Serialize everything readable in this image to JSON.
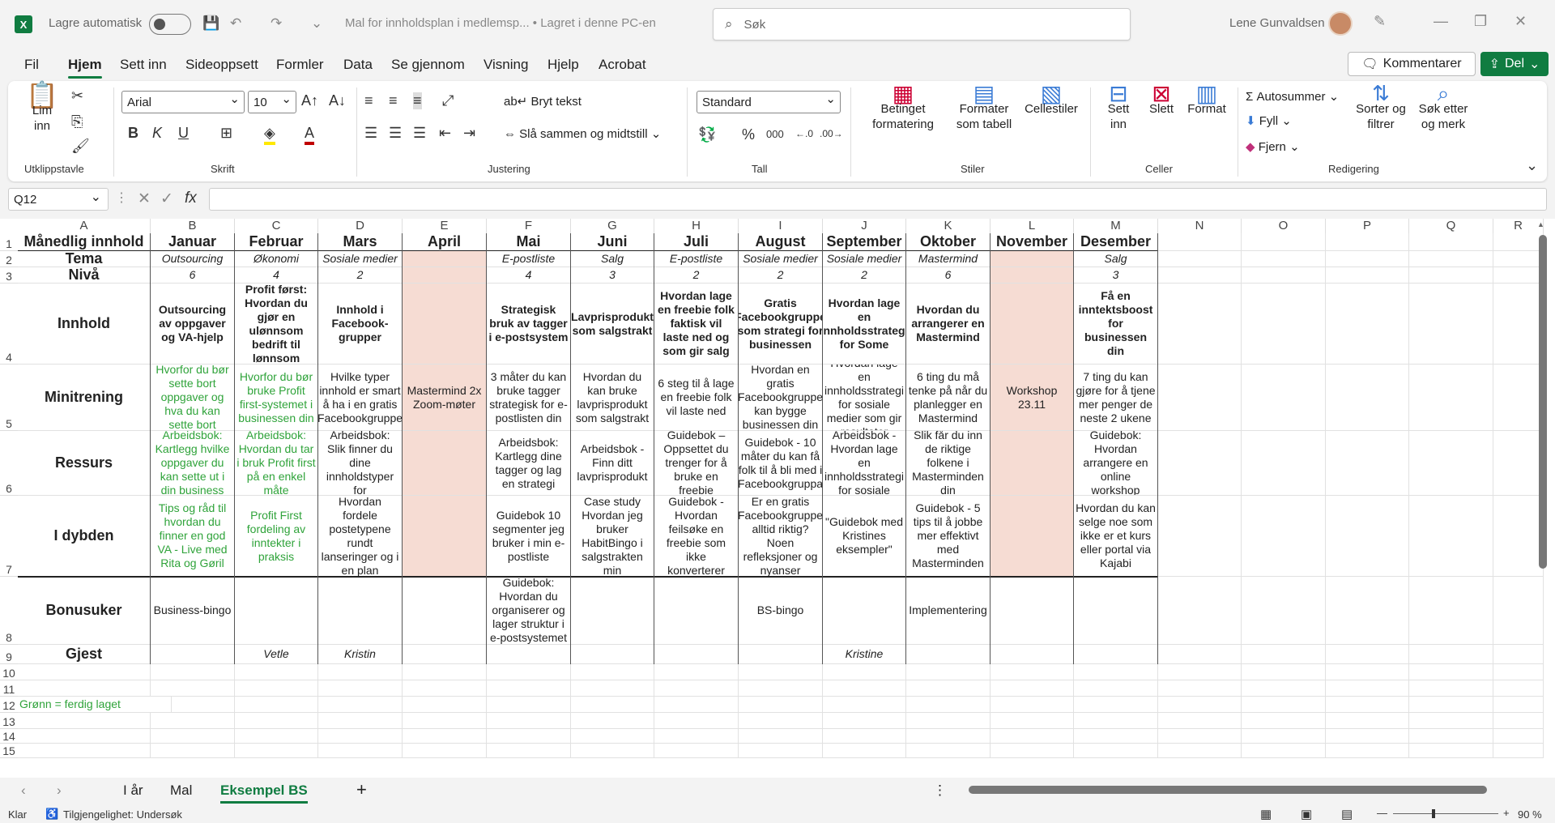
{
  "titlebar": {
    "app_icon": "X",
    "autosave_label": "Lagre automatisk",
    "doc_title": "Mal for innholdsplan i medlemsp...",
    "save_state": "• Lagret i denne PC-en",
    "search_placeholder": "Søk",
    "user_name": "Lene Gunvaldsen"
  },
  "menu": {
    "items": [
      "Fil",
      "Hjem",
      "Sett inn",
      "Sideoppsett",
      "Formler",
      "Data",
      "Se gjennom",
      "Visning",
      "Hjelp",
      "Acrobat"
    ],
    "active": "Hjem",
    "comments_label": "Kommentarer",
    "share_label": "Del"
  },
  "ribbon": {
    "groups": {
      "clipboard": "Utklippstavle",
      "font": "Skrift",
      "alignment": "Justering",
      "number": "Tall",
      "styles": "Stiler",
      "cells": "Celler",
      "editing": "Redigering"
    },
    "paste_label": "Lim inn",
    "font_name": "Arial",
    "font_size": "10",
    "wrap_text": "Bryt tekst",
    "merge_center": "Slå sammen og midtstill",
    "number_format": "Standard",
    "conditional_formatting": "Betinget formatering",
    "format_as_table": "Formater som tabell",
    "cell_styles": "Cellestiler",
    "insert": "Sett inn",
    "delete": "Slett",
    "format": "Format",
    "autosum": "Autosummer",
    "fill": "Fyll",
    "clear": "Fjern",
    "sort_filter": "Sorter og filtrer",
    "find_select": "Søk etter og merk"
  },
  "formula_bar": {
    "name_box": "Q12",
    "formula": ""
  },
  "columns": [
    "A",
    "B",
    "C",
    "D",
    "E",
    "F",
    "G",
    "H",
    "I",
    "J",
    "K",
    "L",
    "M",
    "N",
    "O",
    "P",
    "Q",
    "R"
  ],
  "rows": [
    "1",
    "2",
    "3",
    "4",
    "5",
    "6",
    "7",
    "8",
    "9",
    "10",
    "11",
    "12",
    "13",
    "14",
    "15"
  ],
  "sheet": {
    "row_labels": [
      "Månedlig innhold",
      "Tema",
      "Nivå",
      "Innhold",
      "Minitrening",
      "Ressurs",
      "I dybden",
      "Bonusuker",
      "Gjest"
    ],
    "months": [
      "Januar",
      "Februar",
      "Mars",
      "April",
      "Mai",
      "Juni",
      "Juli",
      "August",
      "September",
      "Oktober",
      "November",
      "Desember"
    ],
    "tema": [
      "Outsourcing",
      "Økonomi",
      "Sosiale medier",
      "",
      "E-postliste",
      "Salg",
      "E-postliste",
      "Sosiale medier",
      "Sosiale medier",
      "Mastermind",
      "",
      "Salg"
    ],
    "niva": [
      "6",
      "4",
      "2",
      "",
      "4",
      "3",
      "2",
      "2",
      "2",
      "6",
      "",
      "3"
    ],
    "innhold": [
      "Outsourcing av oppgaver og VA-hjelp",
      "Profit først: Hvordan du gjør en ulønnsom bedrift til lønnsom",
      "Innhold i Facebook-grupper",
      "",
      "Strategisk bruk av tagger i e-postsystem",
      "Lavprisprodukt som salgstrakt",
      "Hvordan lage en freebie folk faktisk vil laste ned og som gir salg",
      "Gratis Facebookgruppe som strategi for businessen",
      "Hvordan lage en innholdsstrategi for Some",
      "Hvordan du arrangerer en Mastermind",
      "",
      "Få en inntektsboost for businessen din"
    ],
    "minitrening": [
      "Hvorfor du bør sette bort oppgaver og hva du kan sette bort",
      "Hvorfor du bør bruke Profit first-systemet i businessen din",
      "Hvilke typer innhold er smart å ha i en gratis Facebookgruppe",
      "Mastermind 2x Zoom-møter",
      "3 måter du kan bruke tagger strategisk for e-postlisten din",
      "Hvordan du kan bruke lavprisprodukt som salgstrakt",
      "6 steg til å lage en freebie folk vil laste ned",
      "Hvordan en gratis Facebookgruppe kan bygge businessen din",
      "Hvordan lage en innholdsstrategi for sosiale medier som gir resultater",
      "6 ting du må tenke på når du planlegger en Mastermind",
      "Workshop 23.11",
      "7 ting du kan gjøre for å tjene mer penger de neste 2 ukene"
    ],
    "ressurs": [
      "Arbeidsbok: Kartlegg hvilke oppgaver du kan sette ut i din business",
      "Arbeidsbok: Hvordan du tar i bruk Profit first på en enkel måte",
      "Arbeidsbok: Slik finner du dine innholdstyper for",
      "",
      "Arbeidsbok: Kartlegg dine tagger og lag en strategi",
      "Arbeidsbok - Finn ditt lavprisprodukt",
      "Guidebok – Oppsettet du trenger for å bruke en freebie",
      "Guidebok - 10 måter du kan få folk til å bli med i Facebookgruppa",
      "Arbeidsbok - Hvordan lage en innholdsstrategi for sosiale",
      "Slik får du inn de riktige folkene i Masterminden din",
      "",
      "Guidebok: Hvordan arrangere en online workshop"
    ],
    "idybden": [
      "Tips og råd til hvordan du finner en god VA - Live med Rita og Gøril",
      "Profit First fordeling av inntekter i praksis",
      "Hvordan fordele postetypene rundt lanseringer og i en plan",
      "",
      "Guidebok 10 segmenter jeg bruker i min e-postliste",
      "Case study Hvordan jeg bruker HabitBingo i salgstrakten min",
      "Guidebok - Hvordan feilsøke en freebie som ikke konverterer",
      "Er en gratis Facebookgruppe alltid riktig? Noen refleksjoner og nyanser",
      "\"Guidebok med Kristines eksempler\"",
      "Guidebok - 5 tips til å jobbe mer effektivt med Masterminden",
      "",
      "Hvordan du kan selge noe som ikke er et kurs eller portal via Kajabi"
    ],
    "bonusuker": [
      "Business-bingo",
      "",
      "",
      "",
      "Guidebok: Hvordan du organiserer og lager struktur i e-postsystemet",
      "",
      "",
      "BS-bingo",
      "",
      "Implementering",
      "",
      ""
    ],
    "gjest": [
      "",
      "Vetle",
      "Kristin",
      "",
      "",
      "",
      "",
      "",
      "Kristine",
      "",
      "",
      ""
    ],
    "note": "Grønn = ferdig laget"
  },
  "sheet_tabs": [
    "I år",
    "Mal",
    "Eksempel BS"
  ],
  "active_tab": "Eksempel BS",
  "status": {
    "ready": "Klar",
    "accessibility": "Tilgjengelighet: Undersøk",
    "zoom": "90 %"
  },
  "colors": {
    "accent": "#107c41",
    "done_green": "#2fa33a",
    "november_fill": "#f6dcd3"
  }
}
